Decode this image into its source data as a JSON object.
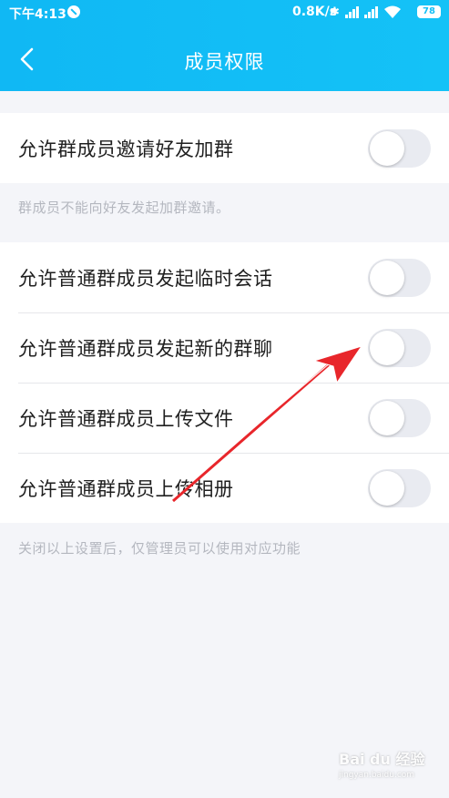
{
  "status_bar": {
    "time": "下午4:13",
    "network_speed": "0.8K/s",
    "battery": "78"
  },
  "header": {
    "title": "成员权限",
    "back_icon": "chevron-left-icon"
  },
  "group1": {
    "rows": [
      {
        "label": "允许群成员邀请好友加群",
        "enabled": false
      }
    ],
    "note": "群成员不能向好友发起加群邀请。"
  },
  "group2": {
    "rows": [
      {
        "label": "允许普通群成员发起临时会话",
        "enabled": false
      },
      {
        "label": "允许普通群成员发起新的群聊",
        "enabled": false
      },
      {
        "label": "允许普通群成员上传文件",
        "enabled": false
      },
      {
        "label": "允许普通群成员上传相册",
        "enabled": false
      }
    ],
    "note": "关闭以上设置后，仅管理员可以使用对应功能"
  },
  "watermark": {
    "text": "Bai du 经验",
    "sub": "jingyan.baidu.com"
  },
  "colors": {
    "header": "#14bdf5",
    "background": "#f4f5f9",
    "toggle_off": "#e9ebf1",
    "annotation_arrow": "#e8262b"
  }
}
